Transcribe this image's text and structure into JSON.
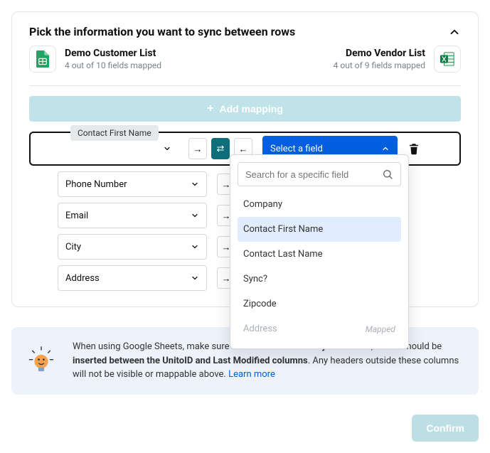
{
  "title": "Pick the information you want to sync between rows",
  "source_left": {
    "name": "Demo Customer List",
    "sub": "4 out of 10 fields mapped"
  },
  "source_right": {
    "name": "Demo Vendor List",
    "sub": "4 out of 9 fields mapped"
  },
  "add_mapping": "Add mapping",
  "rows": [
    {
      "left": "",
      "tooltip": "Contact First Name",
      "right_label": "Select a field"
    },
    {
      "left": "Phone Number"
    },
    {
      "left": "Email"
    },
    {
      "left": "City"
    },
    {
      "left": "Address"
    }
  ],
  "dropdown": {
    "search_placeholder": "Search for a specific field",
    "options": [
      {
        "label": "Company"
      },
      {
        "label": "Contact First Name",
        "highlight": true
      },
      {
        "label": "Contact Last Name"
      },
      {
        "label": "Sync?"
      },
      {
        "label": "Zipcode"
      },
      {
        "label": "Address",
        "mapped": "Mapped",
        "disabled": true
      }
    ]
  },
  "info": {
    "prefix": "When using Google Sheets, make sure the ",
    "bold1": "first row contains your header",
    "mid": ", which should be ",
    "bold2": "inserted between the UnitoID and Last Modified columns",
    "suffix": ". Any headers outside these columns will not be visible or mappable above. ",
    "link": "Learn more"
  },
  "confirm": "Confirm"
}
